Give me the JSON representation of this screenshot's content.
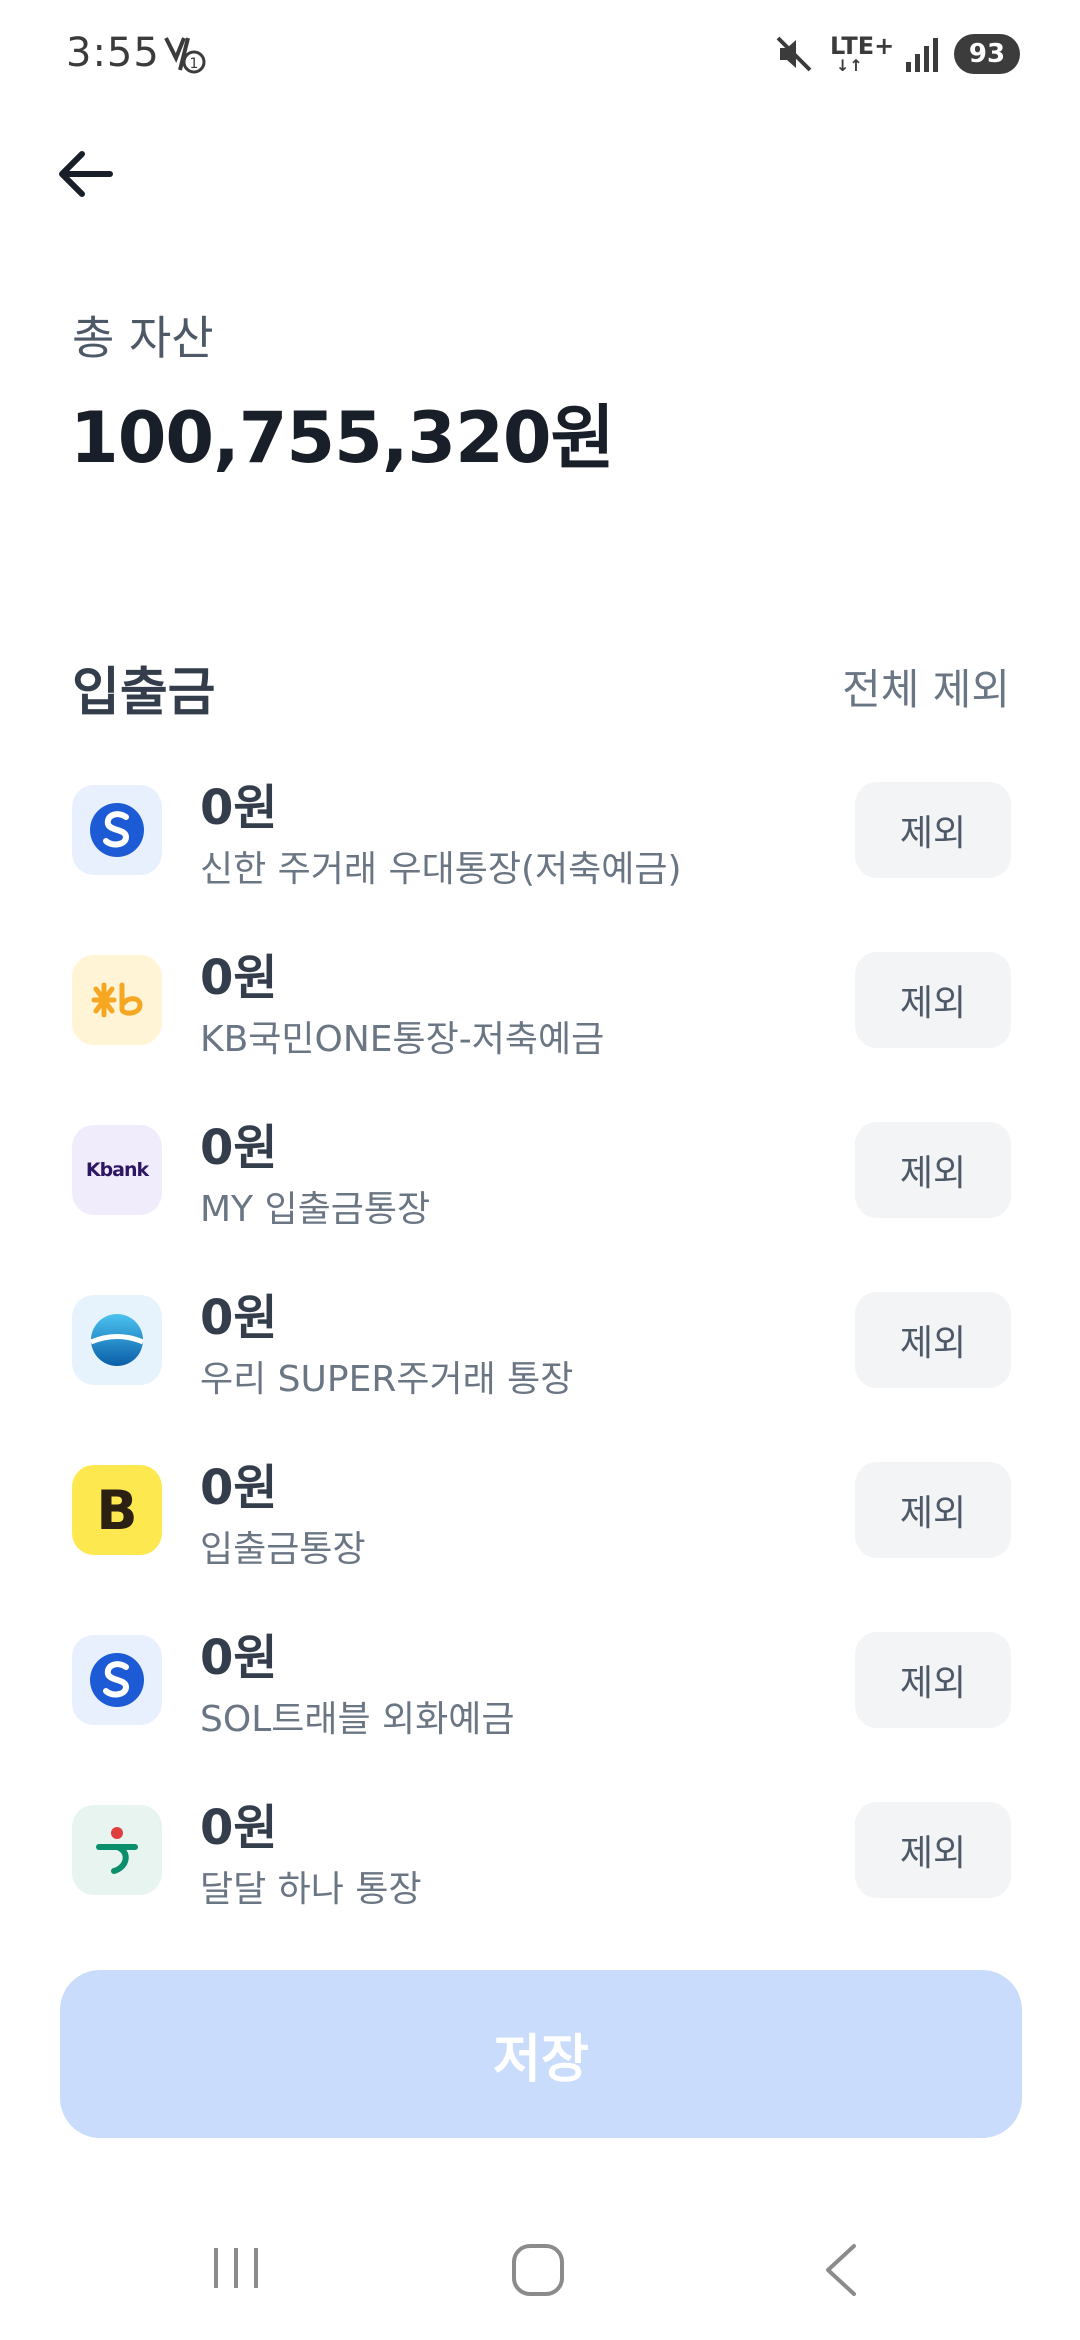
{
  "status_bar": {
    "time": "3:55",
    "network": "LTE+",
    "battery": "93"
  },
  "header": {
    "back_icon": "arrow-left-icon"
  },
  "total": {
    "label": "총 자산",
    "amount": "100,755,320원"
  },
  "section": {
    "title": "입출금",
    "exclude_all_label": "전체 제외"
  },
  "accounts": [
    {
      "amount": "0원",
      "name": "신한 주거래 우대통장(저축예금)",
      "bank_icon": "shinhan-logo-icon",
      "exclude_label": "제외"
    },
    {
      "amount": "0원",
      "name": "KB국민ONE통장-저축예금",
      "bank_icon": "kb-logo-icon",
      "exclude_label": "제외"
    },
    {
      "amount": "0원",
      "name": "MY 입출금통장",
      "bank_icon": "kbank-logo-icon",
      "logo_text": "Kbank",
      "exclude_label": "제외"
    },
    {
      "amount": "0원",
      "name": "우리 SUPER주거래 통장",
      "bank_icon": "woori-logo-icon",
      "exclude_label": "제외"
    },
    {
      "amount": "0원",
      "name": "입출금통장",
      "bank_icon": "kakaobank-logo-icon",
      "logo_text": "B",
      "exclude_label": "제외"
    },
    {
      "amount": "0원",
      "name": "SOL트래블 외화예금",
      "bank_icon": "shinhan-logo-icon",
      "exclude_label": "제외"
    },
    {
      "amount": "0원",
      "name": "달달 하나 통장",
      "bank_icon": "hana-logo-icon",
      "exclude_label": "제외"
    }
  ],
  "save_button": {
    "label": "저장"
  },
  "colors": {
    "primary_text": "#191f28",
    "secondary_text": "#6b7684",
    "button_bg": "#f2f4f6",
    "save_disabled": "#c9dcfc"
  }
}
